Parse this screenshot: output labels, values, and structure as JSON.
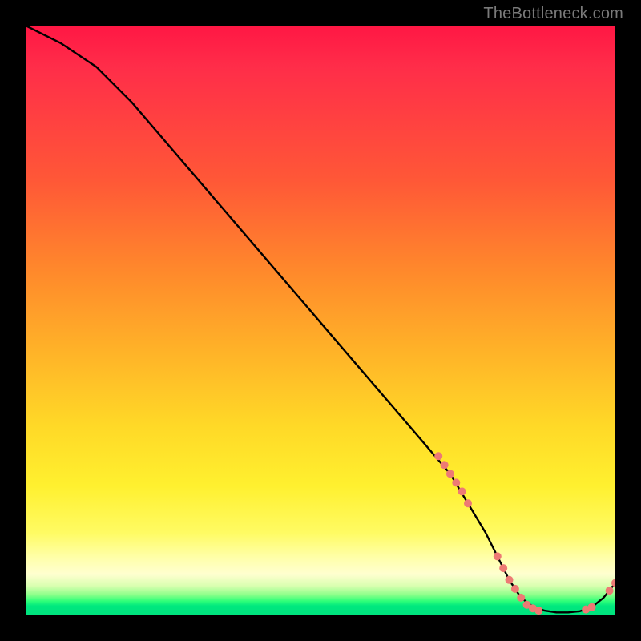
{
  "watermark": "TheBottleneck.com",
  "chart_data": {
    "type": "line",
    "title": "",
    "xlabel": "",
    "ylabel": "",
    "xlim": [
      0,
      100
    ],
    "ylim": [
      0,
      100
    ],
    "grid": false,
    "series": [
      {
        "name": "bottleneck-curve",
        "x": [
          0,
          6,
          12,
          18,
          24,
          30,
          36,
          42,
          48,
          54,
          60,
          66,
          72,
          75,
          78,
          80,
          82,
          84,
          86,
          88,
          90,
          92,
          94,
          96,
          98,
          100
        ],
        "y": [
          100,
          97,
          93,
          87,
          80,
          73,
          66,
          59,
          52,
          45,
          38,
          31,
          24,
          19,
          14,
          10,
          6,
          3,
          1.5,
          0.8,
          0.5,
          0.5,
          0.7,
          1.4,
          3.0,
          5.5
        ]
      }
    ],
    "markers": {
      "name": "highlight-points",
      "x": [
        70,
        71,
        72,
        73,
        74,
        75,
        80,
        81,
        82,
        83,
        84,
        85,
        86,
        87,
        95,
        96,
        99,
        100
      ],
      "y": [
        27,
        25.5,
        24,
        22.5,
        21,
        19,
        10,
        8,
        6,
        4.5,
        3,
        1.8,
        1.2,
        0.8,
        1.0,
        1.4,
        4.2,
        5.5
      ]
    },
    "gradient_stops_pct": {
      "red_top": 0,
      "orange_mid": 45,
      "yellow": 78,
      "pale_yellow": 92,
      "green_band": 97,
      "bottom": 100
    }
  }
}
